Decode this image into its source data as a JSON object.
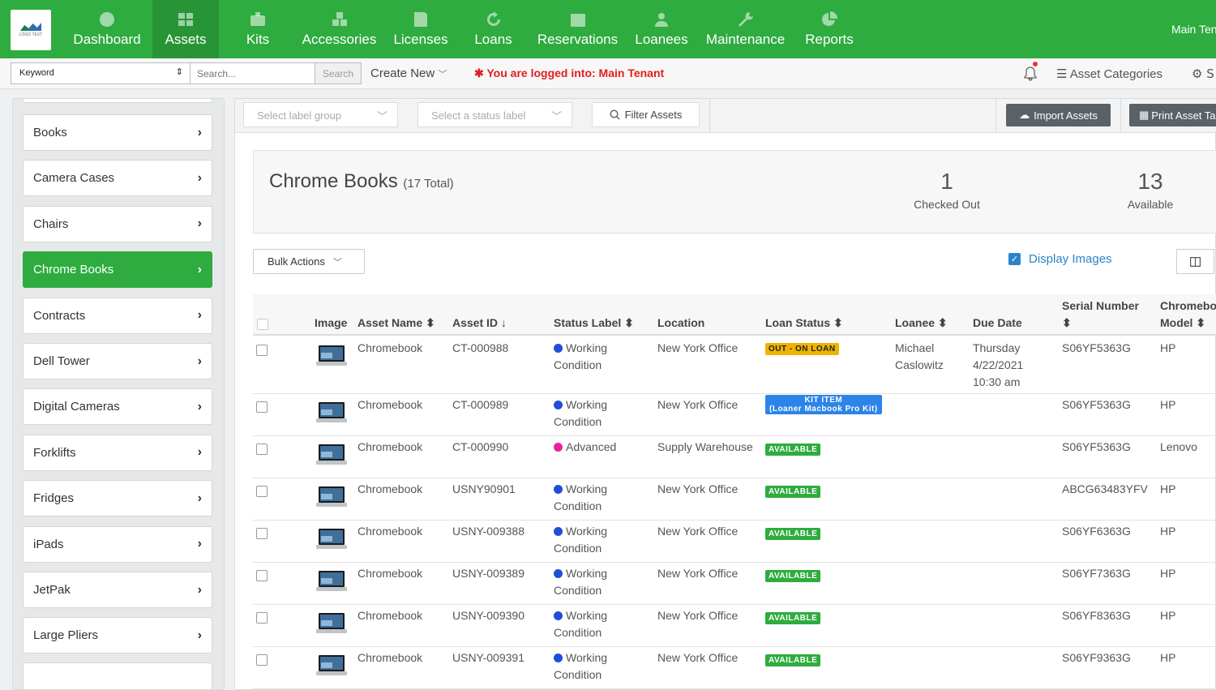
{
  "logo_text": "LOGO TEXT",
  "nav": [
    {
      "label": "Dashboard",
      "icon": "palette-icon"
    },
    {
      "label": "Assets",
      "icon": "grid-icon"
    },
    {
      "label": "Kits",
      "icon": "briefcase-icon"
    },
    {
      "label": "Accessories",
      "icon": "cubes-icon"
    },
    {
      "label": "Licenses",
      "icon": "floppy-icon"
    },
    {
      "label": "Loans",
      "icon": "refresh-icon"
    },
    {
      "label": "Reservations",
      "icon": "calendar-icon"
    },
    {
      "label": "Loanees",
      "icon": "users-icon"
    },
    {
      "label": "Maintenance",
      "icon": "wrench-icon"
    },
    {
      "label": "Reports",
      "icon": "pie-chart-icon"
    }
  ],
  "nav_right": "Main Tenant",
  "search": {
    "type_value": "Keyword",
    "placeholder": "Search...",
    "button": "Search"
  },
  "create_new": "Create New",
  "logged_in": "✱ You are logged into: Main Tenant",
  "asset_categories": "Asset Categories",
  "settings_label": "S",
  "sidebar": [
    "Books",
    "Camera Cases",
    "Chairs",
    "Chrome Books",
    "Contracts",
    "Dell Tower",
    "Digital Cameras",
    "Forklifts",
    "Fridges",
    "iPads",
    "JetPak",
    "Large Pliers"
  ],
  "sidebar_active": "Chrome Books",
  "filters": {
    "label_group": "Select label group",
    "status_label": "Select a status label",
    "filter_btn": "Filter Assets",
    "import_btn": "Import Assets",
    "print_btn": "Print Asset Tags"
  },
  "summary": {
    "title": "Chrome Books",
    "total": "(17 Total)",
    "stats": [
      {
        "num": "1",
        "label": "Checked Out"
      },
      {
        "num": "13",
        "label": "Available"
      }
    ]
  },
  "bulk_actions": "Bulk Actions",
  "display_images": "Display Images",
  "columns": {
    "image": "Image",
    "asset_name": "Asset Name",
    "asset_id": "Asset ID",
    "status": "Status Label",
    "location": "Location",
    "loan_status": "Loan Status",
    "loanee": "Loanee",
    "due_date": "Due Date",
    "serial_1": "Serial Number",
    "model_1": "Chromebook",
    "model_2": "Model"
  },
  "colors": {
    "nav_green": "#2eac3f",
    "working": "#1f4fd6",
    "advanced": "#e6249b",
    "available": "#2eac3f",
    "on_loan": "#f0b400",
    "kit": "#2c84e8"
  },
  "rows": [
    {
      "name": "Chromebook",
      "id": "CT-000988",
      "status1": "Working",
      "status2": "Condition",
      "status_color": "working",
      "location": "New York Office",
      "loan": "OUT - ON LOAN",
      "loan_type": "on_loan",
      "loanee1": "Michael",
      "loanee2": "Caslowitz",
      "due1": "Thursday",
      "due2": "4/22/2021",
      "due3": "10:30 am",
      "serial": "S06YF5363G",
      "model": "HP"
    },
    {
      "name": "Chromebook",
      "id": "CT-000989",
      "status1": "Working",
      "status2": "Condition",
      "status_color": "working",
      "location": "New York Office",
      "loan": "KIT ITEM",
      "loan2": "(Loaner Macbook Pro Kit)",
      "loan_type": "kit",
      "serial": "S06YF5363G",
      "model": "HP"
    },
    {
      "name": "Chromebook",
      "id": "CT-000990",
      "status1": "Advanced",
      "status2": "",
      "status_color": "advanced",
      "location": "Supply Warehouse",
      "loan": "AVAILABLE",
      "loan_type": "available",
      "serial": "S06YF5363G",
      "model": "Lenovo"
    },
    {
      "name": "Chromebook",
      "id": "USNY90901",
      "status1": "Working",
      "status2": "Condition",
      "status_color": "working",
      "location": "New York Office",
      "loan": "AVAILABLE",
      "loan_type": "available",
      "serial": "ABCG63483YFV",
      "model": "HP"
    },
    {
      "name": "Chromebook",
      "id": "USNY-009388",
      "status1": "Working",
      "status2": "Condition",
      "status_color": "working",
      "location": "New York Office",
      "loan": "AVAILABLE",
      "loan_type": "available",
      "serial": "S06YF6363G",
      "model": "HP"
    },
    {
      "name": "Chromebook",
      "id": "USNY-009389",
      "status1": "Working",
      "status2": "Condition",
      "status_color": "working",
      "location": "New York Office",
      "loan": "AVAILABLE",
      "loan_type": "available",
      "serial": "S06YF7363G",
      "model": "HP"
    },
    {
      "name": "Chromebook",
      "id": "USNY-009390",
      "status1": "Working",
      "status2": "Condition",
      "status_color": "working",
      "location": "New York Office",
      "loan": "AVAILABLE",
      "loan_type": "available",
      "serial": "S06YF8363G",
      "model": "HP"
    },
    {
      "name": "Chromebook",
      "id": "USNY-009391",
      "status1": "Working",
      "status2": "Condition",
      "status_color": "working",
      "location": "New York Office",
      "loan": "AVAILABLE",
      "loan_type": "available",
      "serial": "S06YF9363G",
      "model": "HP"
    }
  ]
}
